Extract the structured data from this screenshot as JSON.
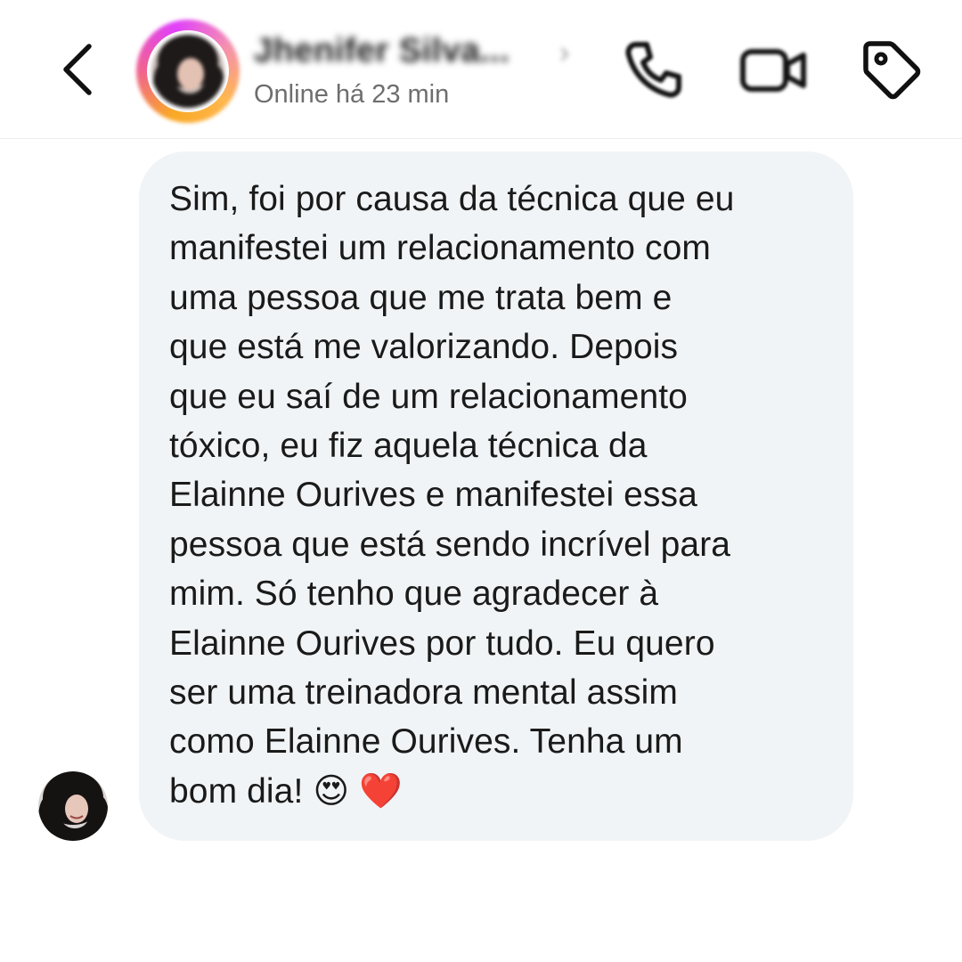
{
  "header": {
    "contact_name": "Jhenifer Silva...",
    "name_chevron": "›",
    "status": "Online há 23 min",
    "icons": {
      "back": "chevron-left-icon",
      "call": "phone-icon",
      "video": "video-camera-icon",
      "label": "tag-icon"
    }
  },
  "message": {
    "text": "Sim, foi por causa da técnica que eu\nmanifestei um relacionamento com\numa pessoa que me trata bem e\nque está me valorizando. Depois\nque eu saí de um relacionamento\ntóxico, eu fiz aquela técnica da\nElainne Ourives e manifestei essa\npessoa que está sendo incrível para\nmim. Só tenho que agradecer à\nElainne Ourives por tudo. Eu quero\nser uma treinadora mental assim\ncomo Elainne Ourives. Tenha um\nbom dia! 😍 ❤️"
  },
  "colors": {
    "bubble_background": "#f1f4f6",
    "status_text": "#6e6e6e",
    "story_ring": [
      "#f9a825",
      "#f06292",
      "#e040fb"
    ]
  }
}
